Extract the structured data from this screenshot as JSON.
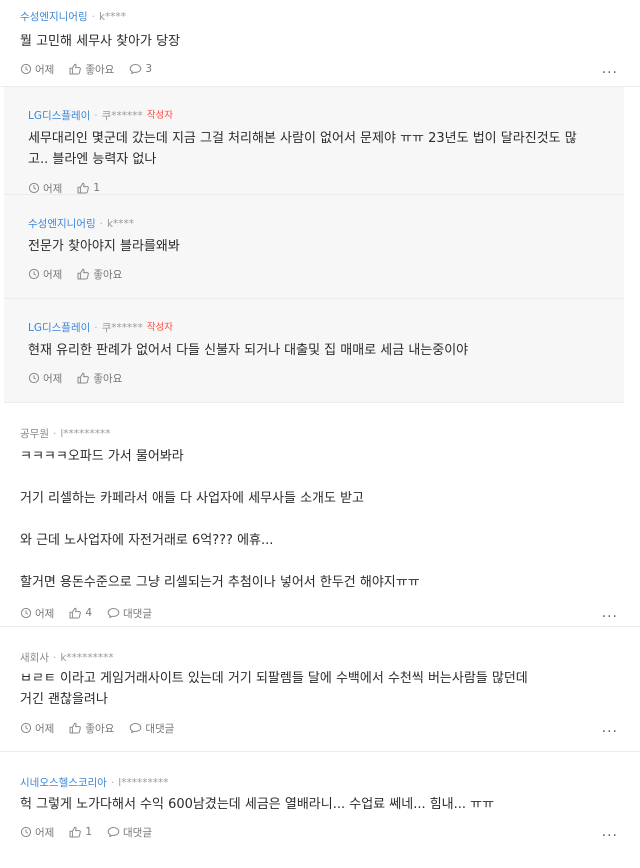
{
  "comments": [
    {
      "id": "c1",
      "company": "수성엔지니어링",
      "nick": "k****",
      "lines": [
        "뭘 고민해 세무사 찾아가 당장"
      ],
      "time": "어제",
      "like_label": "좋아요",
      "reply_label": "3"
    },
    {
      "id": "r1",
      "company": "LG디스플레이",
      "nick": "쿠******",
      "badge": "작성자",
      "lines": [
        "세무대리인 몇군데 갔는데 지금 그걸 처리해본 사람이 없어서 문제야 ㅠㅠ 23년도 법이 달라진것도 많",
        "고.. 블라엔 능력자 없나"
      ],
      "time": "어제",
      "like_label": "1"
    },
    {
      "id": "r2",
      "company": "수성엔지니어링",
      "nick": "k****",
      "lines": [
        "전문가 찾아야지 블라를왜봐"
      ],
      "time": "어제",
      "like_label": "좋아요"
    },
    {
      "id": "r3",
      "company": "LG디스플레이",
      "nick": "쿠******",
      "badge": "작성자",
      "lines": [
        "현재 유리한 판례가 없어서 다들 신불자 되거나 대출및 집 매매로 세금 내는중이야"
      ],
      "time": "어제",
      "like_label": "좋아요"
    },
    {
      "id": "c2",
      "company": "공무원",
      "nick": "l*********",
      "lines": [
        "ㅋㅋㅋㅋ오파드 가서 물어봐라",
        "",
        "거기 리셀하는 카페라서 애들 다 사업자에 세무사들 소개도 받고",
        "",
        "와 근데 노사업자에 자전거래로 6억??? 에휴...",
        "",
        "할거면 용돈수준으로 그냥 리셀되는거 추첨이나 넣어서 한두건 해야지ㅠㅠ"
      ],
      "time": "어제",
      "like_label": "4",
      "reply_label": "대댓글"
    },
    {
      "id": "c3",
      "company": "새회사",
      "nick": "k*********",
      "lines": [
        "ㅂㄹㅌ 이라고 게임거래사이트 있는데 거기 되팔렘들 달에 수백에서 수천씩 버는사람들 많던데",
        "거긴 괜찮을려나"
      ],
      "time": "어제",
      "like_label": "좋아요",
      "reply_label": "대댓글"
    },
    {
      "id": "c4",
      "company": "시네오스헬스코리아",
      "nick": "l*********",
      "lines": [
        "헉 그렇게 노가다해서 수익 600남겼는데 세금은 열배라니... 수업료 쎄네... 힘내... ㅠㅠ"
      ],
      "time": "어제",
      "like_label": "1",
      "reply_label": "대댓글"
    }
  ],
  "more_label": "...",
  "colors": {
    "company_blue": "#3b86d6",
    "badge_red": "#ff4a3d",
    "reply_bg": "#f7f7f8"
  }
}
